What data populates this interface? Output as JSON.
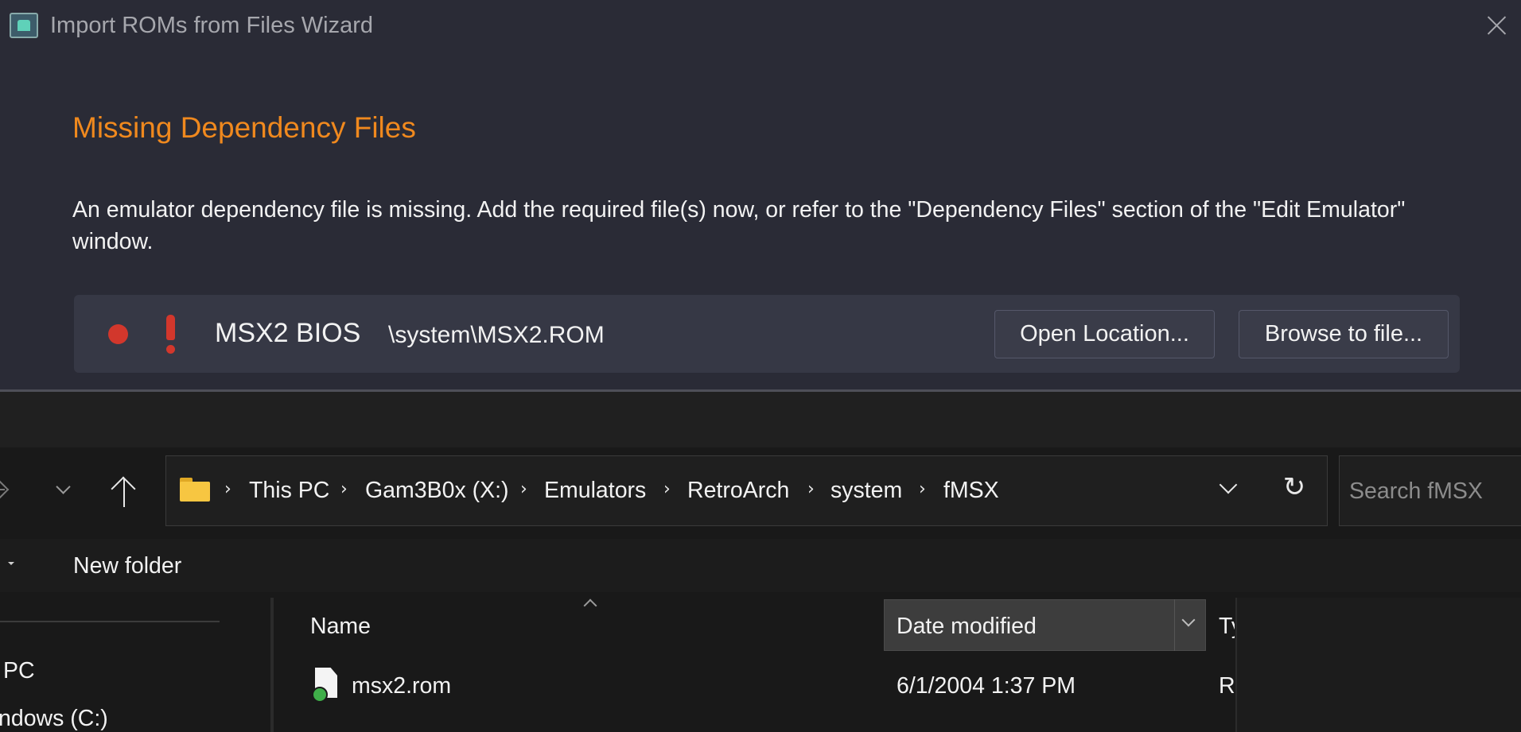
{
  "wizard": {
    "title": "Import ROMs from Files Wizard",
    "heading": "Missing Dependency Files",
    "description": "An emulator dependency file is missing. Add the required file(s) now, or refer to the \"Dependency Files\" section of the \"Edit Emulator\" window.",
    "dependency": {
      "name": "MSX2 BIOS",
      "path": "\\system\\MSX2.ROM",
      "status_color": "#d2372c",
      "open_label": "Open Location...",
      "browse_label": "Browse to file..."
    },
    "heading_color": "#f0891e"
  },
  "explorer": {
    "breadcrumb": [
      "This PC",
      "Gam3B0x (X:)",
      "Emulators",
      "RetroArch",
      "system",
      "fMSX"
    ],
    "search_placeholder": "Search fMSX",
    "new_folder": "New folder",
    "nav_items": [
      "PC",
      "ndows (C:)"
    ],
    "columns": {
      "name": "Name",
      "date": "Date modified",
      "type": "Ty"
    },
    "files": [
      {
        "name": "msx2.rom",
        "date": "6/1/2004 1:37 PM",
        "type": "R"
      }
    ],
    "icons": [
      "forward-arrow-icon",
      "recent-locations-icon",
      "up-arrow-icon",
      "folder-icon",
      "chevron-right-icon",
      "dropdown-icon",
      "refresh-icon",
      "file-icon",
      "sync-check-icon"
    ]
  }
}
